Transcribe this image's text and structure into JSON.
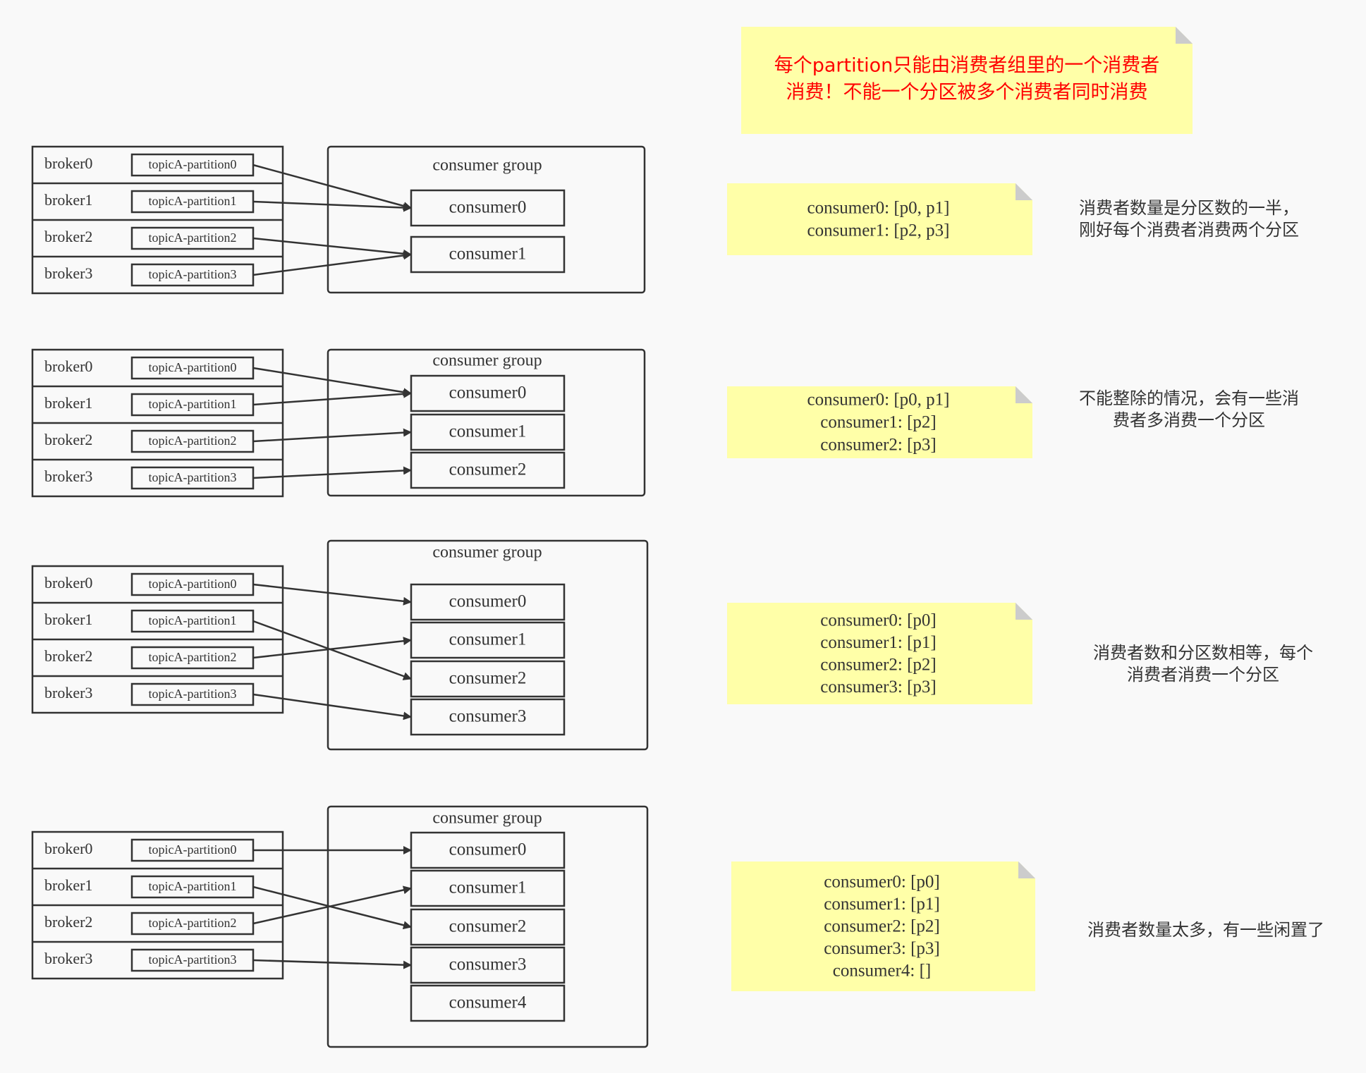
{
  "title_note": {
    "lines": [
      "每个partition只能由消费者组里的一个消费者",
      "消费！不能一个分区被多个消费者同时消费"
    ]
  },
  "panels": [
    {
      "brokers": [
        "broker0",
        "broker1",
        "broker2",
        "broker3"
      ],
      "partitions": [
        "topicA-partition0",
        "topicA-partition1",
        "topicA-partition2",
        "topicA-partition3"
      ],
      "group_label": "consumer group",
      "consumers": [
        "consumer0",
        "consumer1"
      ],
      "assignment": [
        0,
        0,
        1,
        1
      ],
      "note_lines": [
        "consumer0: [p0, p1]",
        "consumer1: [p2, p3]"
      ],
      "comment_lines": [
        "消费者数量是分区数的一半，",
        "刚好每个消费者消费两个分区"
      ]
    },
    {
      "brokers": [
        "broker0",
        "broker1",
        "broker2",
        "broker3"
      ],
      "partitions": [
        "topicA-partition0",
        "topicA-partition1",
        "topicA-partition2",
        "topicA-partition3"
      ],
      "group_label": "consumer group",
      "consumers": [
        "consumer0",
        "consumer1",
        "consumer2"
      ],
      "assignment": [
        0,
        0,
        1,
        2
      ],
      "note_lines": [
        "consumer0: [p0, p1]",
        "consumer1: [p2]",
        "consumer2: [p3]"
      ],
      "comment_lines": [
        "不能整除的情况，会有一些消",
        "费者多消费一个分区"
      ]
    },
    {
      "brokers": [
        "broker0",
        "broker1",
        "broker2",
        "broker3"
      ],
      "partitions": [
        "topicA-partition0",
        "topicA-partition1",
        "topicA-partition2",
        "topicA-partition3"
      ],
      "group_label": "consumer group",
      "consumers": [
        "consumer0",
        "consumer1",
        "consumer2",
        "consumer3"
      ],
      "assignment": [
        0,
        2,
        1,
        3
      ],
      "note_lines": [
        "consumer0: [p0]",
        "consumer1: [p1]",
        "consumer2: [p2]",
        "consumer3: [p3]"
      ],
      "comment_lines": [
        "消费者数和分区数相等，每个",
        "消费者消费一个分区"
      ]
    },
    {
      "brokers": [
        "broker0",
        "broker1",
        "broker2",
        "broker3"
      ],
      "partitions": [
        "topicA-partition0",
        "topicA-partition1",
        "topicA-partition2",
        "topicA-partition3"
      ],
      "group_label": "consumer group",
      "consumers": [
        "consumer0",
        "consumer1",
        "consumer2",
        "consumer3",
        "consumer4"
      ],
      "assignment": [
        0,
        2,
        1,
        3
      ],
      "note_lines": [
        "consumer0: [p0]",
        "consumer1: [p1]",
        "consumer2: [p2]",
        "consumer3: [p3]",
        "consumer4: []"
      ],
      "comment_lines": [
        "消费者数量太多，有一些闲置了"
      ]
    }
  ],
  "colors": {
    "background": "#f9f9f9",
    "note_fill": "#ffffa8",
    "note_fold": "#cccccc",
    "stroke": "#333333",
    "title_text": "#ff0000"
  }
}
